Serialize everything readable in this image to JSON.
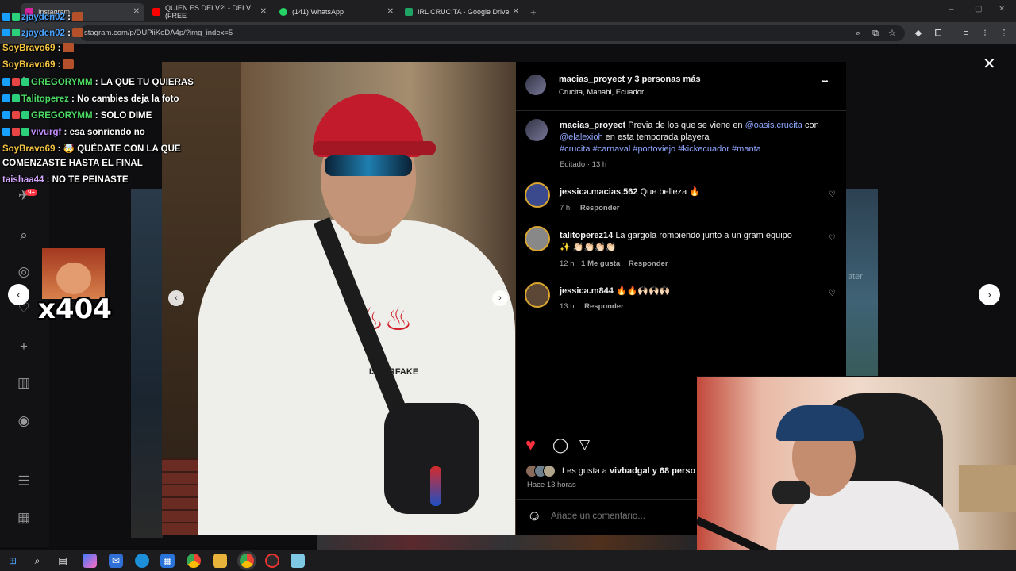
{
  "browser": {
    "tabs": [
      {
        "label": "Instagram",
        "color": "#d6249f"
      },
      {
        "label": "QUIEN ES DEI V?! - DEI V (FREE",
        "color": "#ff0000"
      },
      {
        "label": "(141) WhatsApp",
        "color": "#25d366"
      },
      {
        "label": "IRL CRUCITA - Google Drive",
        "color": "#1fa463"
      }
    ],
    "new_tab": "+",
    "url": "stagram.com/p/DUPiiKeDA4p/?img_index=5",
    "window_controls": {
      "minimize": "–",
      "maximize": "▢",
      "close": "✕"
    }
  },
  "post": {
    "header_user": "macias_proyect",
    "header_suffix": " y 3 personas más",
    "location": "Crucita, Manabi, Ecuador",
    "more_icon": "•••",
    "caption": {
      "user": "macias_proyect",
      "text_1": "Previa de los que se viene en",
      "mention_1": "@oasis.crucita",
      "text_2": "con",
      "mention_2": "@elalexioh",
      "text_3": "en esta temporada playera",
      "hashtags": "#crucita #carnaval #portoviejo #kickecuador #manta",
      "meta": "Editado · 13 h"
    },
    "comments": [
      {
        "user": "jessica.macias.562",
        "text": "Que belleza 🔥",
        "time": "7 h",
        "likes": "",
        "reply": "Responder"
      },
      {
        "user": "talitoperez14",
        "text": "La gargola rompiendo junto a un gram equipo",
        "text2": "✨ 👏🏻👏🏻👏🏻👏🏻",
        "time": "12 h",
        "likes": "1 Me gusta",
        "reply": "Responder"
      },
      {
        "user": "jessica.m844",
        "text": "🔥🔥🙌🏻🙌🏻🙌🏻",
        "time": "13 h",
        "likes": "",
        "reply": "Responder"
      }
    ],
    "likes_prefix": "Les gusta a ",
    "likes_user": "vivbadgal",
    "likes_suffix": " y 68 perso",
    "posted_ago": "Hace 13 horas",
    "comment_placeholder": "Añade un comentario...",
    "shirt_print": "ISPERFAKE",
    "close_icon": "✕",
    "accent_like": "#ff3040"
  },
  "chat": [
    {
      "user": "zjayden02",
      "text": " :",
      "user_color": "#4aa3ff",
      "emote": true
    },
    {
      "user": "SoyBravo69",
      "text": " :",
      "user_color": "#f5c542",
      "emote": true
    },
    {
      "user": "GREGORYMM",
      "text": " : LA QUE TU QUIERAS",
      "user_color": "#4cd964",
      "emote": false
    },
    {
      "user": "Talitoperez",
      "text": " : No cambies deja la foto",
      "user_color": "#4cd964",
      "emote": false
    },
    {
      "user": "GREGORYMM",
      "text": " : SOLO DIME",
      "user_color": "#4cd964",
      "emote": false
    },
    {
      "user": "vivurgf",
      "text": " : esa sonriendo no",
      "user_color": "#c48cff",
      "emote": false
    },
    {
      "user": "SoyBravo69",
      "text": " : 🤯 QUÉDATE CON LA QUE",
      "user_color": "#f5c542",
      "emote": false
    },
    {
      "user": "",
      "text": "COMENZASTE HASTA EL FINAL",
      "user_color": "#ffffff",
      "emote": false
    },
    {
      "user": "taishaa44",
      "text": " : NO TE PEINASTE",
      "user_color": "#d6a8ff",
      "emote": false
    }
  ],
  "meme_counter": "x404",
  "sidebar_badge": "9+",
  "blur_word": "ater"
}
